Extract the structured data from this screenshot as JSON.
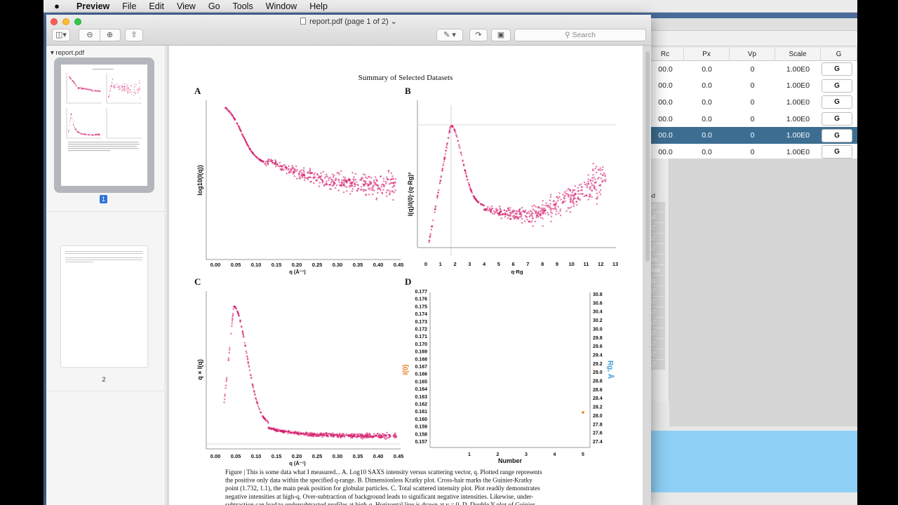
{
  "menubar": {
    "apple": "",
    "app": "Preview",
    "items": [
      "File",
      "Edit",
      "View",
      "Go",
      "Tools",
      "Window",
      "Help"
    ]
  },
  "window": {
    "title": "report.pdf (page 1 of 2)",
    "search_placeholder": "Search"
  },
  "sidebar": {
    "doc_name": "report.pdf",
    "pages": [
      "1",
      "2"
    ]
  },
  "figure": {
    "title": "Summary of Selected Datasets",
    "panels": [
      "A",
      "B",
      "C",
      "D"
    ],
    "A": {
      "ylabel": "log10(I(q))",
      "xlabel": "q (Å⁻¹)",
      "xticks": [
        "0.00",
        "0.05",
        "0.10",
        "0.15",
        "0.20",
        "0.25",
        "0.30",
        "0.35",
        "0.40",
        "0.45"
      ]
    },
    "B": {
      "ylabel": "I(q)/I(0)·(q·Rg)²",
      "xlabel": "q·Rg",
      "xticks": [
        "0",
        "1",
        "2",
        "3",
        "4",
        "5",
        "6",
        "7",
        "8",
        "9",
        "10",
        "11",
        "12",
        "13"
      ]
    },
    "C": {
      "ylabel": "q × I(q)",
      "xlabel": "q (Å⁻¹)",
      "xticks": [
        "0.00",
        "0.05",
        "0.10",
        "0.15",
        "0.20",
        "0.25",
        "0.30",
        "0.35",
        "0.40",
        "0.45"
      ]
    },
    "D": {
      "ylabel_left": "I(0)",
      "ylabel_right": "Rg, Å",
      "xlabel": "Number",
      "xticks": [
        "1",
        "2",
        "3",
        "4",
        "5"
      ],
      "yticks_left": [
        "0.177",
        "0.176",
        "0.175",
        "0.174",
        "0.173",
        "0.172",
        "0.171",
        "0.170",
        "0.169",
        "0.168",
        "0.167",
        "0.166",
        "0.165",
        "0.164",
        "0.163",
        "0.162",
        "0.161",
        "0.160",
        "0.159",
        "0.158",
        "0.157"
      ],
      "yticks_right": [
        "30.8",
        "30.6",
        "30.4",
        "30.2",
        "30.0",
        "29.8",
        "29.6",
        "29.4",
        "29.2",
        "29.0",
        "28.8",
        "28.6",
        "28.4",
        "28.2",
        "28.0",
        "27.8",
        "27.6",
        "27.4"
      ]
    },
    "caption_lines": [
      "Figure | This is some data what I measured... A. Log10 SAXS intensity versus scattering vector, q. Plotted range represents",
      "the positive only data within the specified q-range. B. Dimensionless Kratky plot. Cross-hair marks the Guinier-Kratky",
      "point (1.732, 1.1), the main peak position for globular particles. C. Total scattered intensity plot. Plot readily demonstrates",
      "negative intensities at high-q. Over-subtraction of background leads to significant negative intensities. Likewise, under-",
      "subtraction can lead to undersubtracted profiles at high-q. Horizontal line is drawn at y = 0. D. Double Y-plot of Guinier"
    ]
  },
  "bg_table": {
    "headers": [
      "Rc",
      "Px",
      "Vp",
      "Scale",
      "G"
    ],
    "rows": [
      [
        "00.0",
        "0.0",
        "0",
        "1.00E0",
        "G"
      ],
      [
        "00.0",
        "0.0",
        "0",
        "1.00E0",
        "G"
      ],
      [
        "00.0",
        "0.0",
        "0",
        "1.00E0",
        "G"
      ],
      [
        "00.0",
        "0.0",
        "0",
        "1.00E0",
        "G"
      ],
      [
        "00.0",
        "0.0",
        "0",
        "1.00E0",
        "G"
      ],
      [
        "00.0",
        "0.0",
        "0",
        "1.00E0",
        "G"
      ]
    ],
    "selected_row": 4,
    "panel_header": "nd",
    "panel_items": [
      "DF",
      "DF",
      "AT",
      "AT",
      "AT",
      "ain",
      "olde",
      "rip",
      "AT",
      "AT",
      "AT",
      "AT",
      "AT",
      "AT",
      "AT",
      "AT"
    ]
  },
  "colors": {
    "data": "#d6186a",
    "accent": "#2d74da",
    "selected": "#3d6e92",
    "rg_point": "#e8801e"
  }
}
